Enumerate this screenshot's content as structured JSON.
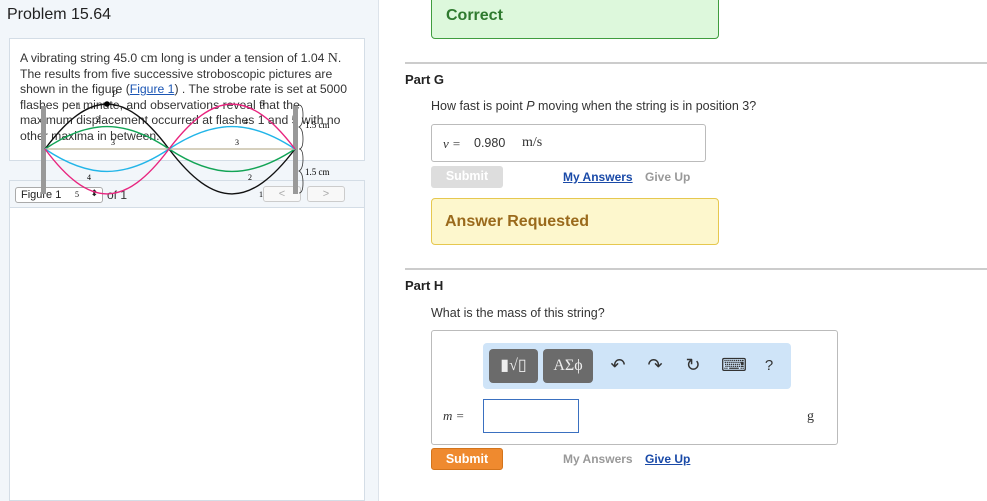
{
  "problem": {
    "title": "Problem 15.64",
    "text_parts": [
      "A vibrating string 45.0 ",
      "cm",
      " long is under a tension of 1.04 ",
      "N",
      ". The results from five successive stroboscopic pictures are shown in the figure (",
      "Figure 1",
      ") . The strobe rate is set at 5000 flashes per minute, and observations reveal that the maximum displacement occurred at flashes 1 and 5 with no other maxima in between."
    ]
  },
  "figure_nav": {
    "selected": "Figure 1",
    "of_label": "of 1",
    "prev": "<",
    "next": ">"
  },
  "figure": {
    "point_label": "P",
    "amplitude_label_top": "1.5 cm",
    "amplitude_label_bottom": "1.5 cm",
    "curve_labels": {
      "left": [
        "1",
        "2",
        "3",
        "4",
        "5"
      ],
      "right": [
        "5",
        "4",
        "3",
        "2",
        "1"
      ]
    },
    "colors": {
      "1": "#111111",
      "2": "#13a456",
      "3": "#c8c0a8",
      "4": "#22b5e8",
      "5": "#e8257f"
    }
  },
  "status_correct": "Correct",
  "part_g": {
    "label": "Part G",
    "question_pre": "How fast is point ",
    "question_var": "P",
    "question_post": " moving when the string is in position 3?",
    "var": "v =",
    "value": "0.980",
    "unit": "m/s",
    "submit": "Submit",
    "my_answers": "My Answers",
    "give_up": "Give Up",
    "status": "Answer Requested"
  },
  "part_h": {
    "label": "Part H",
    "question": "What is the mass of this string?",
    "toolbar": {
      "templates": "▮√▯",
      "greek": "ΑΣϕ",
      "undo": "↶",
      "redo": "↷",
      "reset": "↻",
      "keyboard": "⌨",
      "help": "?"
    },
    "var": "m =",
    "value": "",
    "unit": "g",
    "submit": "Submit",
    "my_answers": "My Answers",
    "give_up": "Give Up"
  }
}
